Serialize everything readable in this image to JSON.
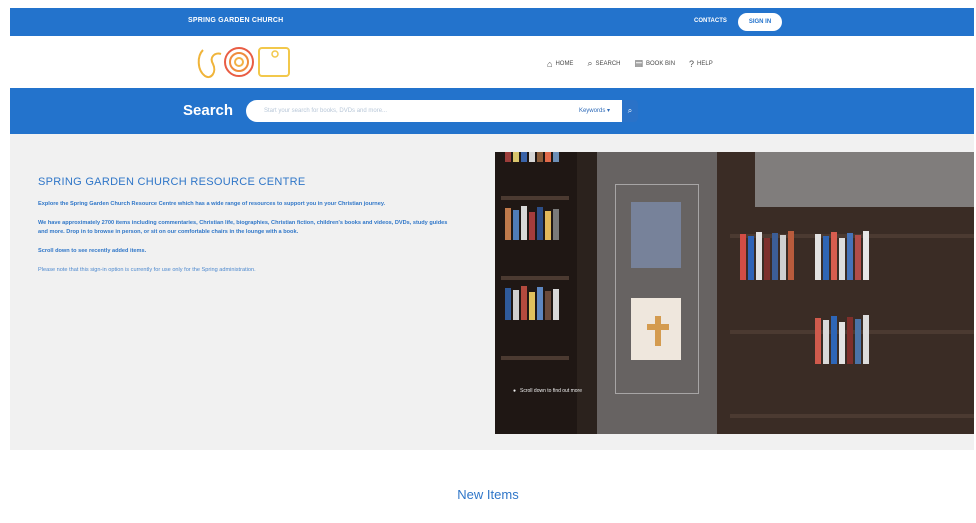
{
  "topbar": {
    "site_name": "SPRING GARDEN CHURCH",
    "contacts": "CONTACTS",
    "sign_in": "SIGN IN"
  },
  "nav": {
    "home": "HOME",
    "search": "SEARCH",
    "book_bin": "BOOK BIN",
    "help": "HELP"
  },
  "search": {
    "label": "Search",
    "placeholder": "Start your search for books, DVDs and more...",
    "scope": "Keywords"
  },
  "hero": {
    "title": "SPRING GARDEN CHURCH RESOURCE CENTRE",
    "p1": "Explore the Spring Garden Church Resource Centre which has a wide range of resources to support you in your Christian journey.",
    "p2": "We have approximately 2700 items including commentaries, Christian life, biographies, Christian fiction, children's books and videos, DVDs, study guides and more. Drop in to browse in person, or sit on our comfortable chairs in the lounge with a book.",
    "p3": "Scroll down to see recently added items.",
    "p4": "Please note that this sign-in option is currently for use only for the Spring administration."
  },
  "photo": {
    "caption": "Scroll down to find out more"
  },
  "sections": {
    "new_items": "New Items"
  }
}
